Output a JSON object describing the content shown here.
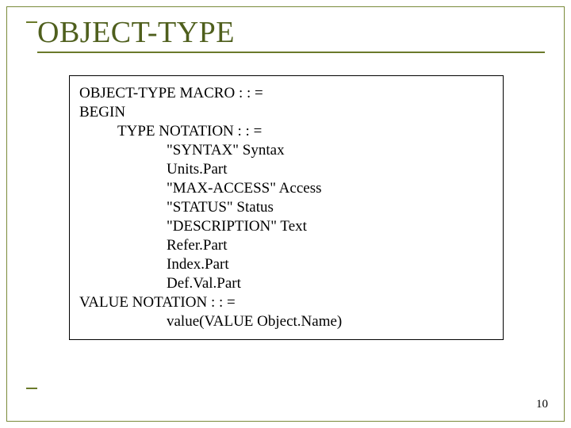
{
  "title": "OBJECT-TYPE",
  "code": {
    "l0": "OBJECT-TYPE MACRO : : =",
    "l1": "BEGIN",
    "l2": "TYPE NOTATION : : =",
    "l3": "\"SYNTAX\" Syntax",
    "l4": "Units.Part",
    "l5": "\"MAX-ACCESS\" Access",
    "l6": "\"STATUS\" Status",
    "l7": "\"DESCRIPTION\" Text",
    "l8": "Refer.Part",
    "l9": "Index.Part",
    "l10": "Def.Val.Part",
    "l11": "VALUE NOTATION : : =",
    "l12": "value(VALUE Object.Name)"
  },
  "page_number": "10"
}
